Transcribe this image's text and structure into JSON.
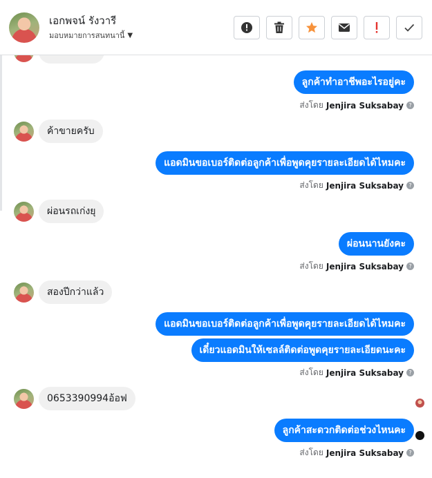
{
  "header": {
    "name": "เอกพจน์ รังวารี",
    "subtitle": "มอบหมายการสนทนานี้",
    "toolbar": {
      "alert_icon": "exclamation-circle-icon",
      "delete_icon": "trash-icon",
      "star_icon": "star-icon",
      "mail_icon": "envelope-icon",
      "important_icon": "exclamation-icon",
      "done_icon": "check-icon"
    }
  },
  "conversation": {
    "sent_by_label": "ส่งโดย",
    "agent_name": "Jenjira Suksabay",
    "messages": [
      {
        "direction": "out",
        "text": "ลูกค้าทำอาชีพอะไรอยู่คะ"
      },
      {
        "direction": "in",
        "text": "ค้าขายครับ"
      },
      {
        "direction": "out",
        "text": "แอดมินขอเบอร์ติดต่อลูกค้าเพื่อพูดคุยรายละเอียดได้ไหมคะ"
      },
      {
        "direction": "in",
        "text": "ผ่อนรถเก่งยุ"
      },
      {
        "direction": "out",
        "text": "ผ่อนนานยังคะ"
      },
      {
        "direction": "in",
        "text": "สองปีกว่าแล้ว"
      },
      {
        "direction": "out",
        "text": "แอดมินขอเบอร์ติดต่อลูกค้าเพื่อพูดคุยรายละเอียดได้ไหมคะ"
      },
      {
        "direction": "out",
        "text": "เดี๋ยวแอดมินให้เซลล์ติดต่อพูดคุยรายละเอียดนะคะ"
      },
      {
        "direction": "in",
        "text": "0653390994อ้อฟ"
      },
      {
        "direction": "out",
        "text": "ลูกค้าสะดวกติดต่อช่วงไหนคะ"
      }
    ]
  }
}
